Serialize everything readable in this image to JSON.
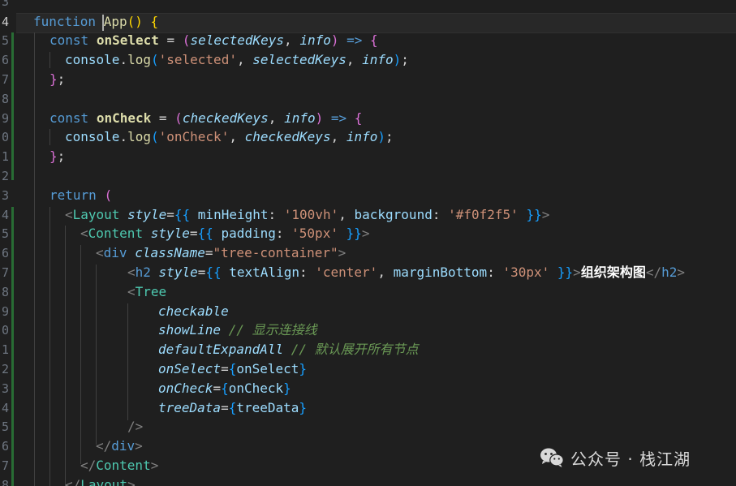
{
  "line_numbers": [
    "3",
    "4",
    "5",
    "6",
    "7",
    "8",
    "9",
    "0",
    "1",
    "2",
    "3",
    "4",
    "5",
    "6",
    "7",
    "8",
    "9",
    "0",
    "1",
    "2",
    "3",
    "4",
    "5",
    "6",
    "7",
    "8"
  ],
  "active_line": "4",
  "code": {
    "l1": {
      "function": "function",
      "name": "App",
      "parens": "()",
      "brace": "{"
    },
    "l2": {
      "const": "const",
      "name": "onSelect",
      "eq": "=",
      "open": "(",
      "p1": "selectedKeys",
      "comma": ",",
      "p2": "info",
      "close": ")",
      "arrow": "=>",
      "brace": "{"
    },
    "l3": {
      "obj": "console",
      "dot": ".",
      "method": "log",
      "open": "(",
      "str": "'selected'",
      "comma1": ",",
      "a1": "selectedKeys",
      "comma2": ",",
      "a2": "info",
      "close": ")",
      "semi": ";"
    },
    "l4": {
      "close": "}",
      "semi": ";"
    },
    "l5": {
      "const": "const",
      "name": "onCheck",
      "eq": "=",
      "open": "(",
      "p1": "checkedKeys",
      "comma": ",",
      "p2": "info",
      "close": ")",
      "arrow": "=>",
      "brace": "{"
    },
    "l6": {
      "obj": "console",
      "dot": ".",
      "method": "log",
      "open": "(",
      "str": "'onCheck'",
      "comma1": ",",
      "a1": "checkedKeys",
      "comma2": ",",
      "a2": "info",
      "close": ")",
      "semi": ";"
    },
    "l7": {
      "close": "}",
      "semi": ";"
    },
    "l8": {
      "return": "return",
      "open": "("
    },
    "l9": {
      "lt": "<",
      "tag": "Layout",
      "attr": "style",
      "eq": "=",
      "open": "{{",
      "k1": "minHeight",
      "colon1": ":",
      "v1": "'100vh'",
      "comma": ",",
      "k2": "background",
      "colon2": ":",
      "v2": "'#f0f2f5'",
      "close": "}}",
      "gt": ">"
    },
    "l10": {
      "lt": "<",
      "tag": "Content",
      "attr": "style",
      "eq": "=",
      "open": "{{",
      "k1": "padding",
      "colon1": ":",
      "v1": "'50px'",
      "close": "}}",
      "gt": ">"
    },
    "l11": {
      "lt": "<",
      "tag": "div",
      "attr": "className",
      "eq": "=",
      "val": "\"tree-container\"",
      "gt": ">"
    },
    "l12": {
      "lt": "<",
      "tag": "h2",
      "attr": "style",
      "eq": "=",
      "open": "{{",
      "k1": "textAlign",
      "colon1": ":",
      "v1": "'center'",
      "comma": ",",
      "k2": "marginBottom",
      "colon2": ":",
      "v2": "'30px'",
      "close": "}}",
      "gt": ">",
      "text": "组织架构图",
      "lt2": "</",
      "tag2": "h2",
      "gt2": ">"
    },
    "l13": {
      "lt": "<",
      "tag": "Tree"
    },
    "l14": {
      "attr": "checkable"
    },
    "l15": {
      "attr": "showLine",
      "comment": "// 显示连接线"
    },
    "l16": {
      "attr": "defaultExpandAll",
      "comment": "// 默认展开所有节点"
    },
    "l17": {
      "attr": "onSelect",
      "eq": "=",
      "open": "{",
      "val": "onSelect",
      "close": "}"
    },
    "l18": {
      "attr": "onCheck",
      "eq": "=",
      "open": "{",
      "val": "onCheck",
      "close": "}"
    },
    "l19": {
      "attr": "treeData",
      "eq": "=",
      "open": "{",
      "val": "treeData",
      "close": "}"
    },
    "l20": {
      "close": "/>"
    },
    "l21": {
      "lt": "</",
      "tag": "div",
      "gt": ">"
    },
    "l22": {
      "lt": "</",
      "tag": "Content",
      "gt": ">"
    },
    "l23": {
      "lt": "</",
      "tag": "Layout",
      "gt": ">"
    }
  },
  "watermark": {
    "icon": "wechat-icon",
    "text": "公众号 · 栈江湖"
  }
}
